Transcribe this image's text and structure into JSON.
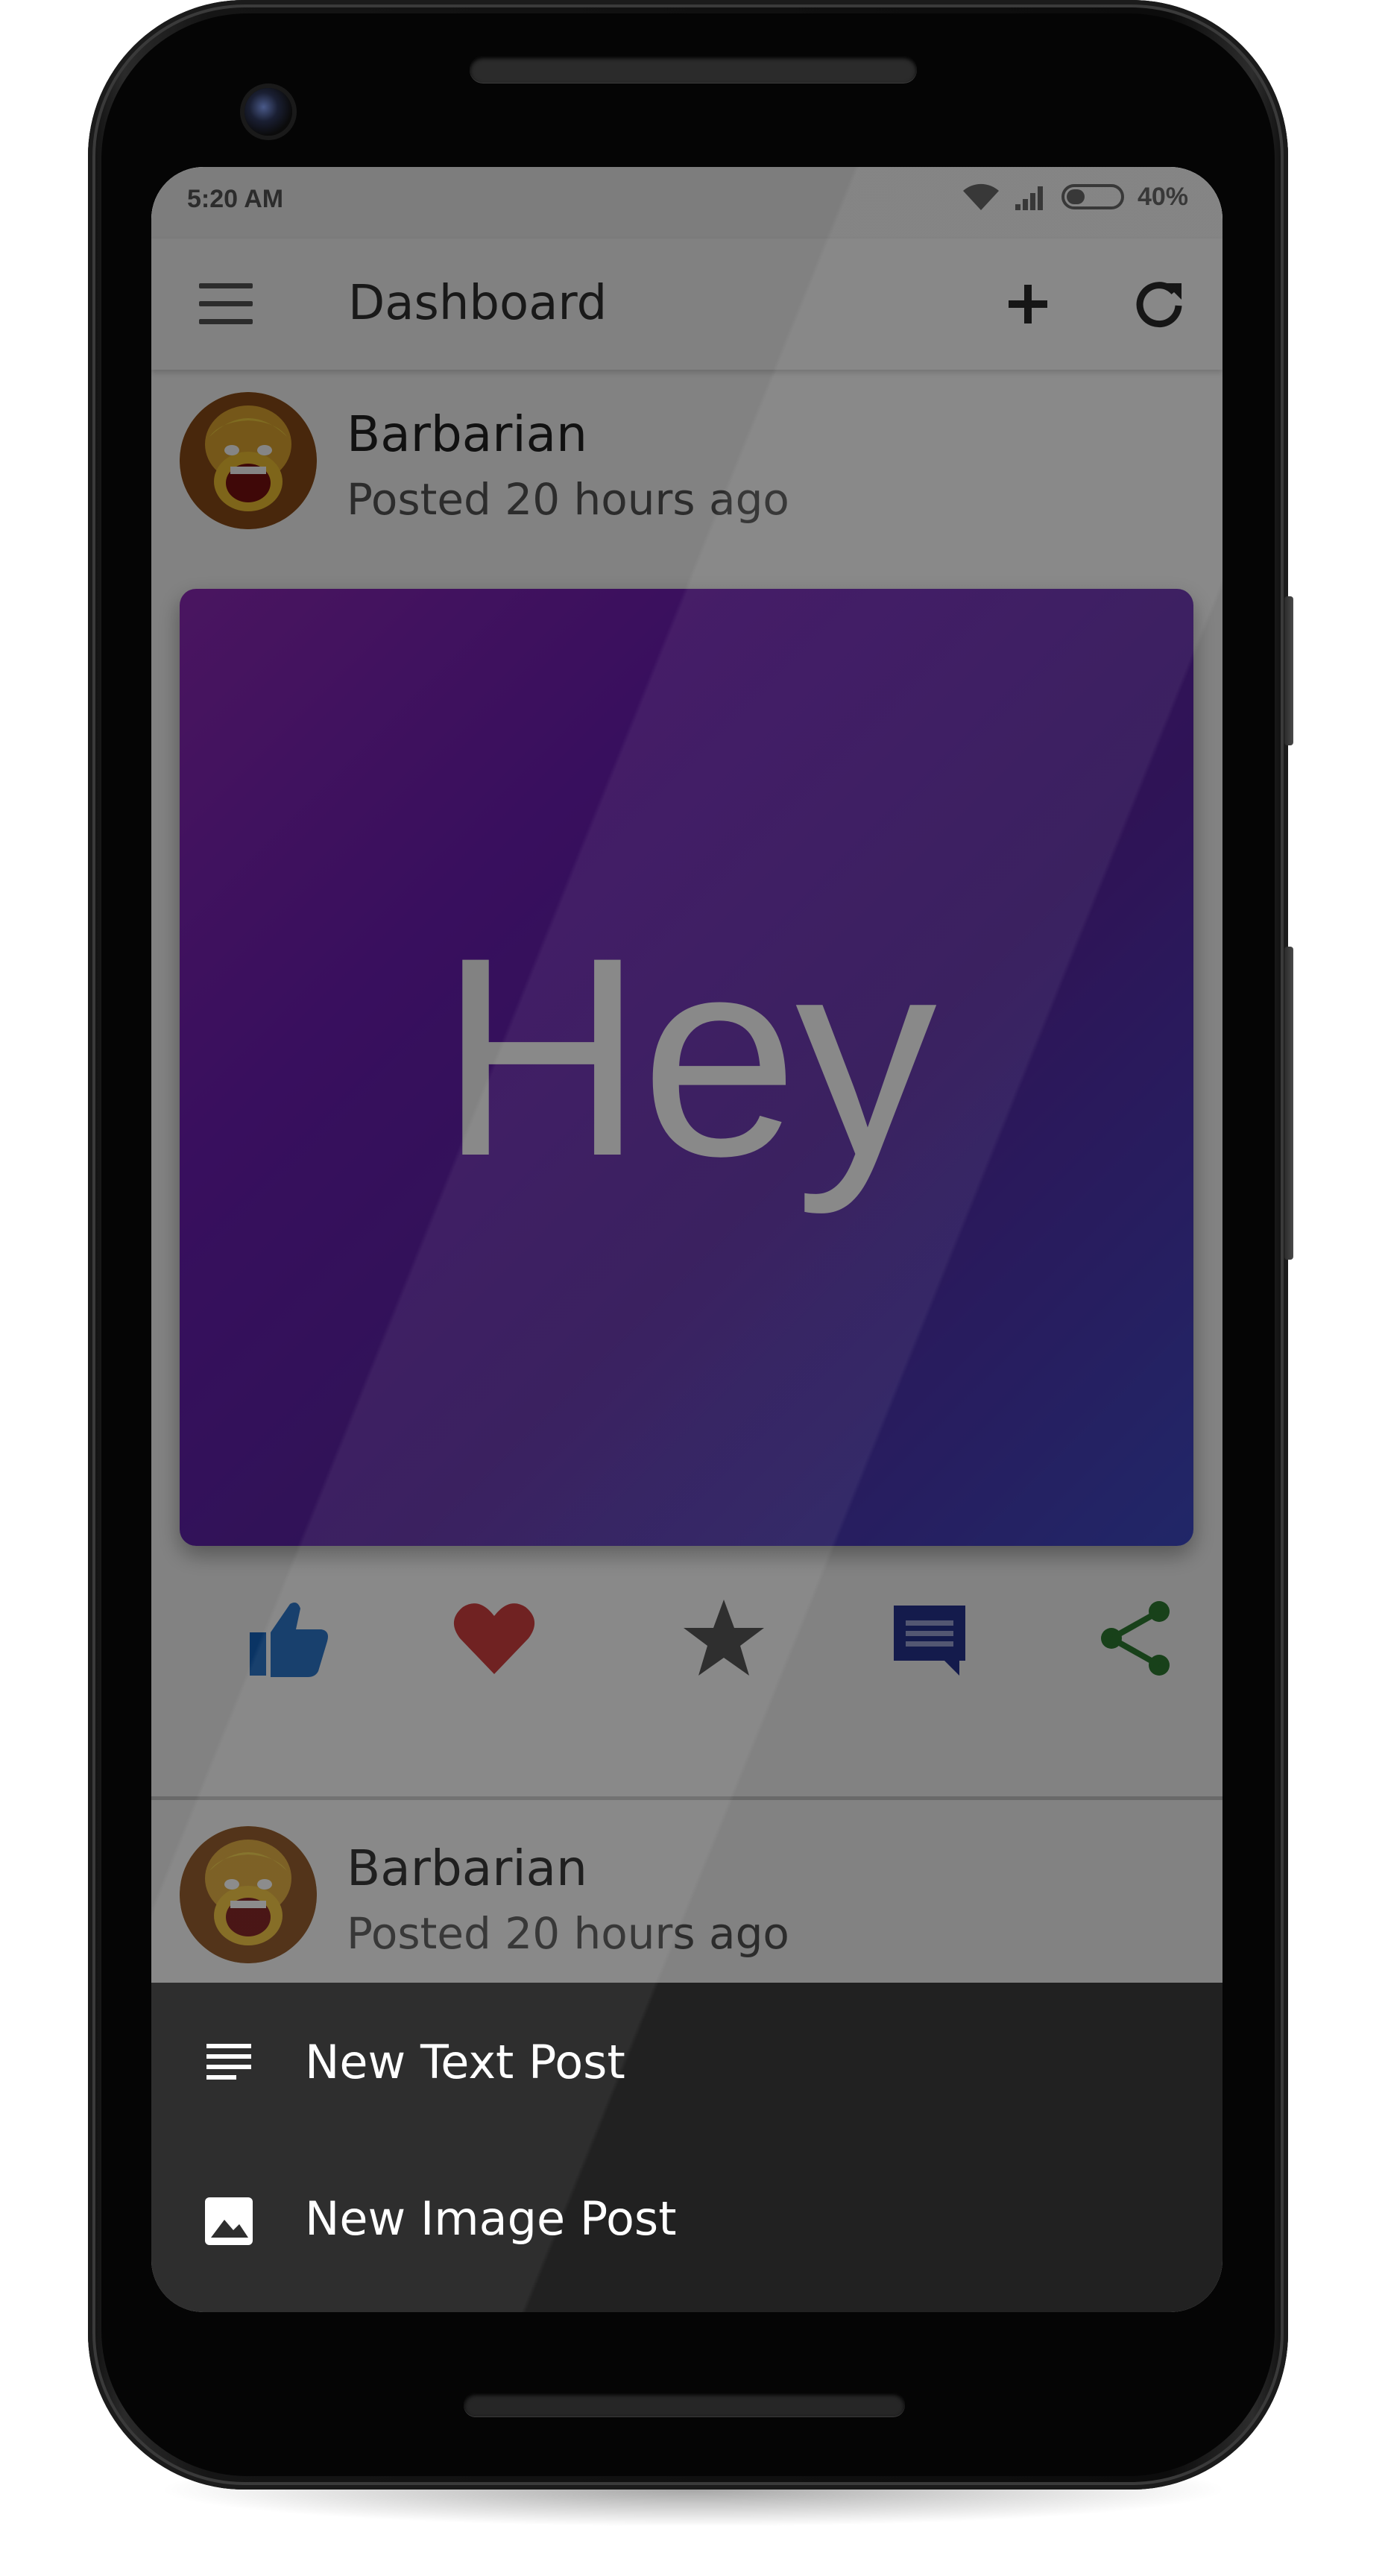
{
  "status_bar": {
    "time": "5:20 AM",
    "battery": "40%",
    "battery_level": 0.4
  },
  "app_bar": {
    "title": "Dashboard",
    "menu_icon": "menu-icon",
    "add_icon": "plus-icon",
    "refresh_icon": "refresh-icon"
  },
  "posts": [
    {
      "author": "Barbarian",
      "posted": "Posted 20 hours ago",
      "content": "Hey",
      "actions": [
        {
          "icon": "thumbs-up-icon",
          "color": "#1565c0"
        },
        {
          "icon": "heart-icon",
          "color": "#c62828"
        },
        {
          "icon": "star-icon",
          "color": "#424242"
        },
        {
          "icon": "comment-icon",
          "color": "#283593"
        },
        {
          "icon": "share-icon",
          "color": "#2e7d32"
        }
      ]
    },
    {
      "author": "Barbarian",
      "posted": "Posted 20 hours ago"
    }
  ],
  "bottom_sheet": {
    "items": [
      {
        "label": "New Text Post",
        "icon": "text-lines-icon"
      },
      {
        "label": "New Image Post",
        "icon": "image-icon"
      }
    ]
  }
}
